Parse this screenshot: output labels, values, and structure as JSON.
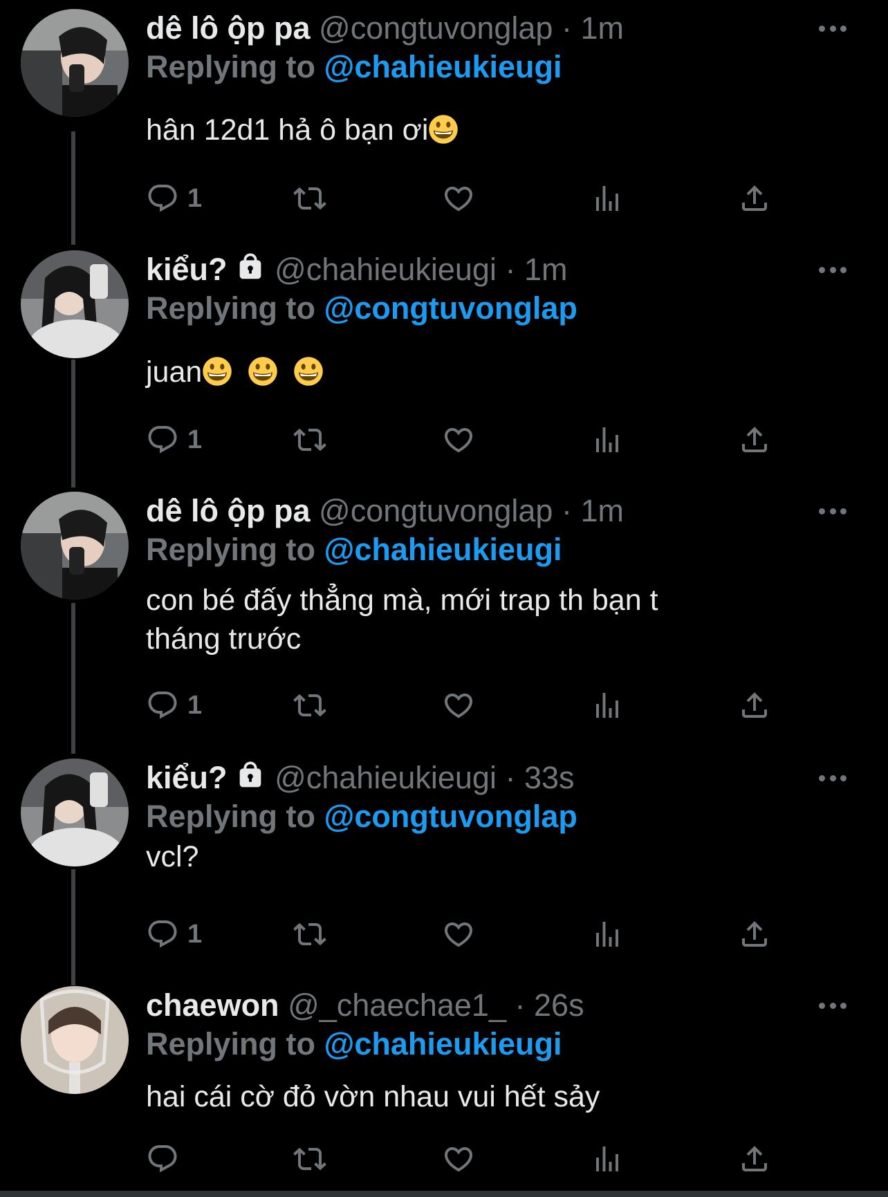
{
  "replying_label": "Replying to",
  "tweets": [
    {
      "name": "dê lô ộp pa",
      "handle": "@congtuvonglap",
      "time": "1m",
      "reply_to": "@chahieukieugi",
      "text": "hân 12d1 hả ô bạn ơi",
      "reply_count": "1"
    },
    {
      "name": "kiểu?",
      "handle": "@chahieukieugi",
      "time": "1m",
      "reply_to": "@congtuvonglap",
      "text": "juan",
      "reply_count": "1"
    },
    {
      "name": "dê lô ộp pa",
      "handle": "@congtuvonglap",
      "time": "1m",
      "reply_to": "@chahieukieugi",
      "text_line1": "con bé đấy thẳng mà, mới trap th bạn t",
      "text_line2": "tháng trước",
      "reply_count": "1"
    },
    {
      "name": "kiểu?",
      "handle": "@chahieukieugi",
      "time": "33s",
      "reply_to": "@congtuvonglap",
      "text": "vcl?",
      "reply_count": "1"
    },
    {
      "name": "chaewon",
      "handle": "@_chaechae1_",
      "time": "26s",
      "reply_to": "@chahieukieugi",
      "text": "hai cái cờ đỏ vờn nhau vui hết sảy",
      "reply_count": ""
    }
  ],
  "separator": "·",
  "icons": [
    "reply-icon",
    "retweet-icon",
    "like-icon",
    "views-icon",
    "share-icon",
    "more-icon",
    "lock-icon",
    "grinning-emoji"
  ],
  "colors": {
    "background": "#000000",
    "text": "#e7e9ea",
    "muted": "#71767b",
    "link": "#1d9bf0",
    "thread_line": "#3e4144"
  }
}
